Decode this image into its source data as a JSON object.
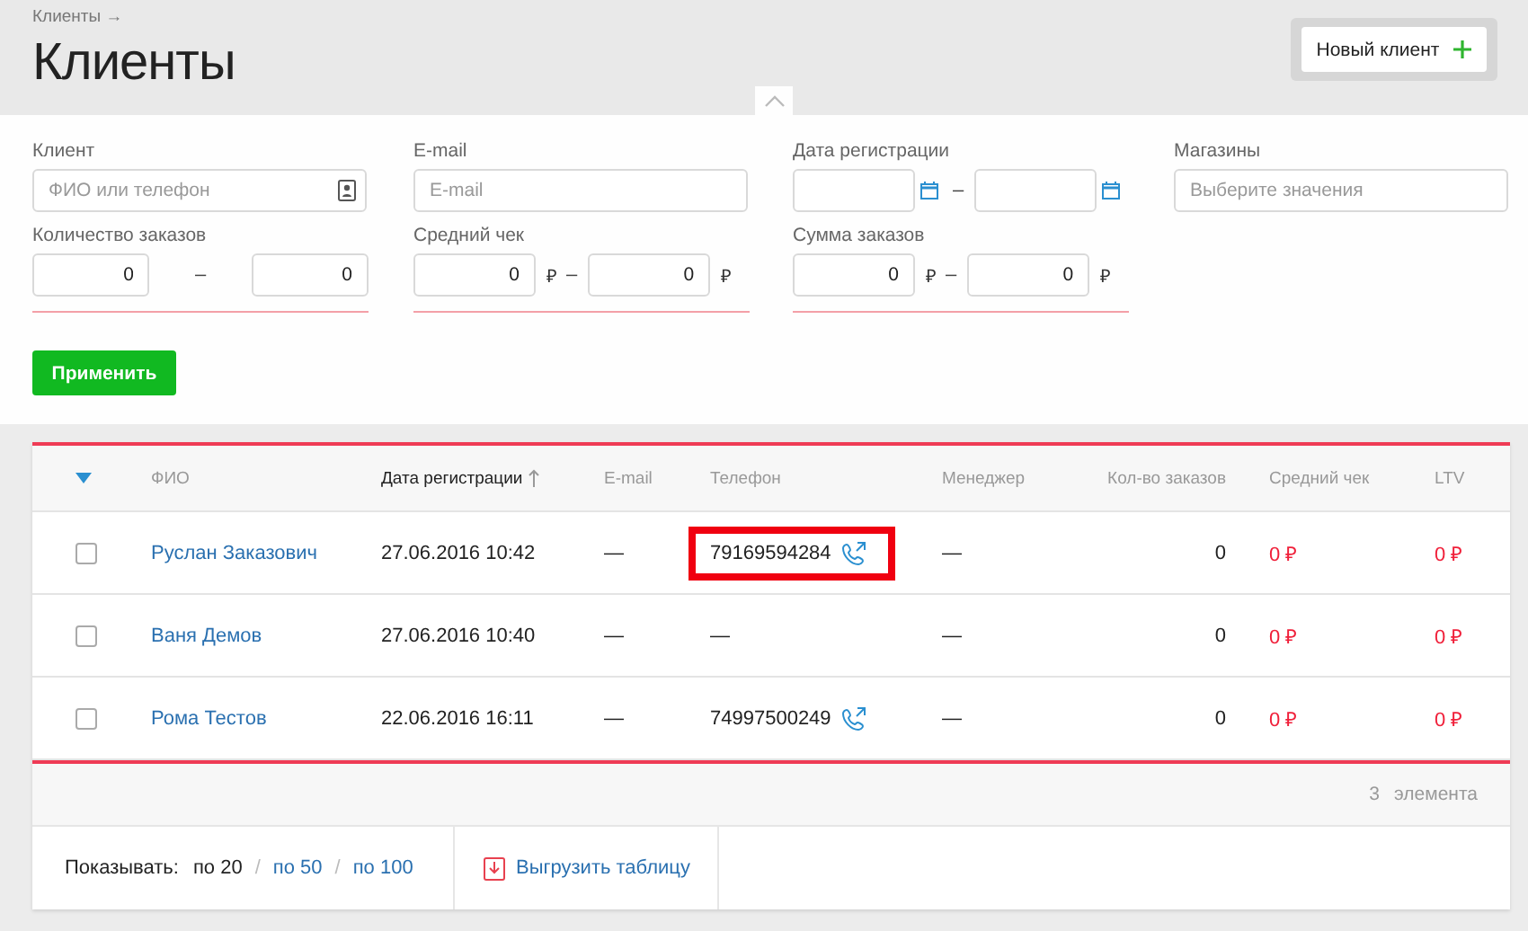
{
  "breadcrumb": "Клиенты →",
  "title": "Клиенты",
  "new_button": {
    "label": "Новый клиент"
  },
  "filters": [
    {
      "kind": "text",
      "label": "Клиент",
      "placeholder": "ФИО или телефон"
    },
    {
      "kind": "email",
      "label": "E-mail",
      "placeholder": "E-mail"
    },
    {
      "kind": "daterange",
      "label": "Дата регистрации",
      "separator": "–"
    },
    {
      "kind": "select",
      "label": "Магазины",
      "placeholder": "Выберите значения"
    },
    {
      "kind": "range",
      "label": "Количество заказов",
      "from": "0",
      "to": "0",
      "separator": "–"
    },
    {
      "kind": "range",
      "label": "Средний чек",
      "from": "0",
      "to": "0",
      "separator": "–",
      "currency": "₽"
    },
    {
      "kind": "range",
      "label": "Сумма заказов",
      "from": "0",
      "to": "0",
      "separator": "–",
      "currency": "₽"
    }
  ],
  "apply_button": "Применить",
  "table": {
    "columns": [
      {
        "label": "ФИО",
        "sorted": false
      },
      {
        "label": "Дата регистрации",
        "sorted": true
      },
      {
        "label": "E-mail",
        "sorted": false
      },
      {
        "label": "Телефон",
        "sorted": false
      },
      {
        "label": "Менеджер",
        "sorted": false
      },
      {
        "label": "Кол-во заказов",
        "sorted": false
      },
      {
        "label": "Средний чек",
        "sorted": false
      },
      {
        "label": "LTV",
        "sorted": false
      }
    ],
    "rows": [
      {
        "checked": false,
        "name": "Руслан Заказович",
        "date": "27.06.2016 10:42",
        "email": "—",
        "phone": "79169594284",
        "callable": true,
        "highlighted": true,
        "manager": "—",
        "orders": "0",
        "avg": "0 ₽",
        "ltv": "0 ₽"
      },
      {
        "checked": false,
        "name": "Ваня Демов",
        "date": "27.06.2016 10:40",
        "email": "—",
        "phone": "—",
        "callable": false,
        "highlighted": false,
        "manager": "—",
        "orders": "0",
        "avg": "0 ₽",
        "ltv": "0 ₽"
      },
      {
        "checked": false,
        "name": "Рома Тестов",
        "date": "22.06.2016 16:11",
        "email": "—",
        "phone": "74997500249",
        "callable": true,
        "highlighted": false,
        "manager": "—",
        "orders": "0",
        "avg": "0 ₽",
        "ltv": "0 ₽"
      }
    ],
    "total_count": "3",
    "total_unit": "элемента"
  },
  "footer": {
    "show_label": "Показывать:",
    "separator": "/",
    "page_sizes": [
      {
        "label": "по 20",
        "selected": true
      },
      {
        "label": "по 50",
        "selected": false
      },
      {
        "label": "по 100",
        "selected": false
      }
    ],
    "export_link": "Выгрузить таблицу"
  }
}
